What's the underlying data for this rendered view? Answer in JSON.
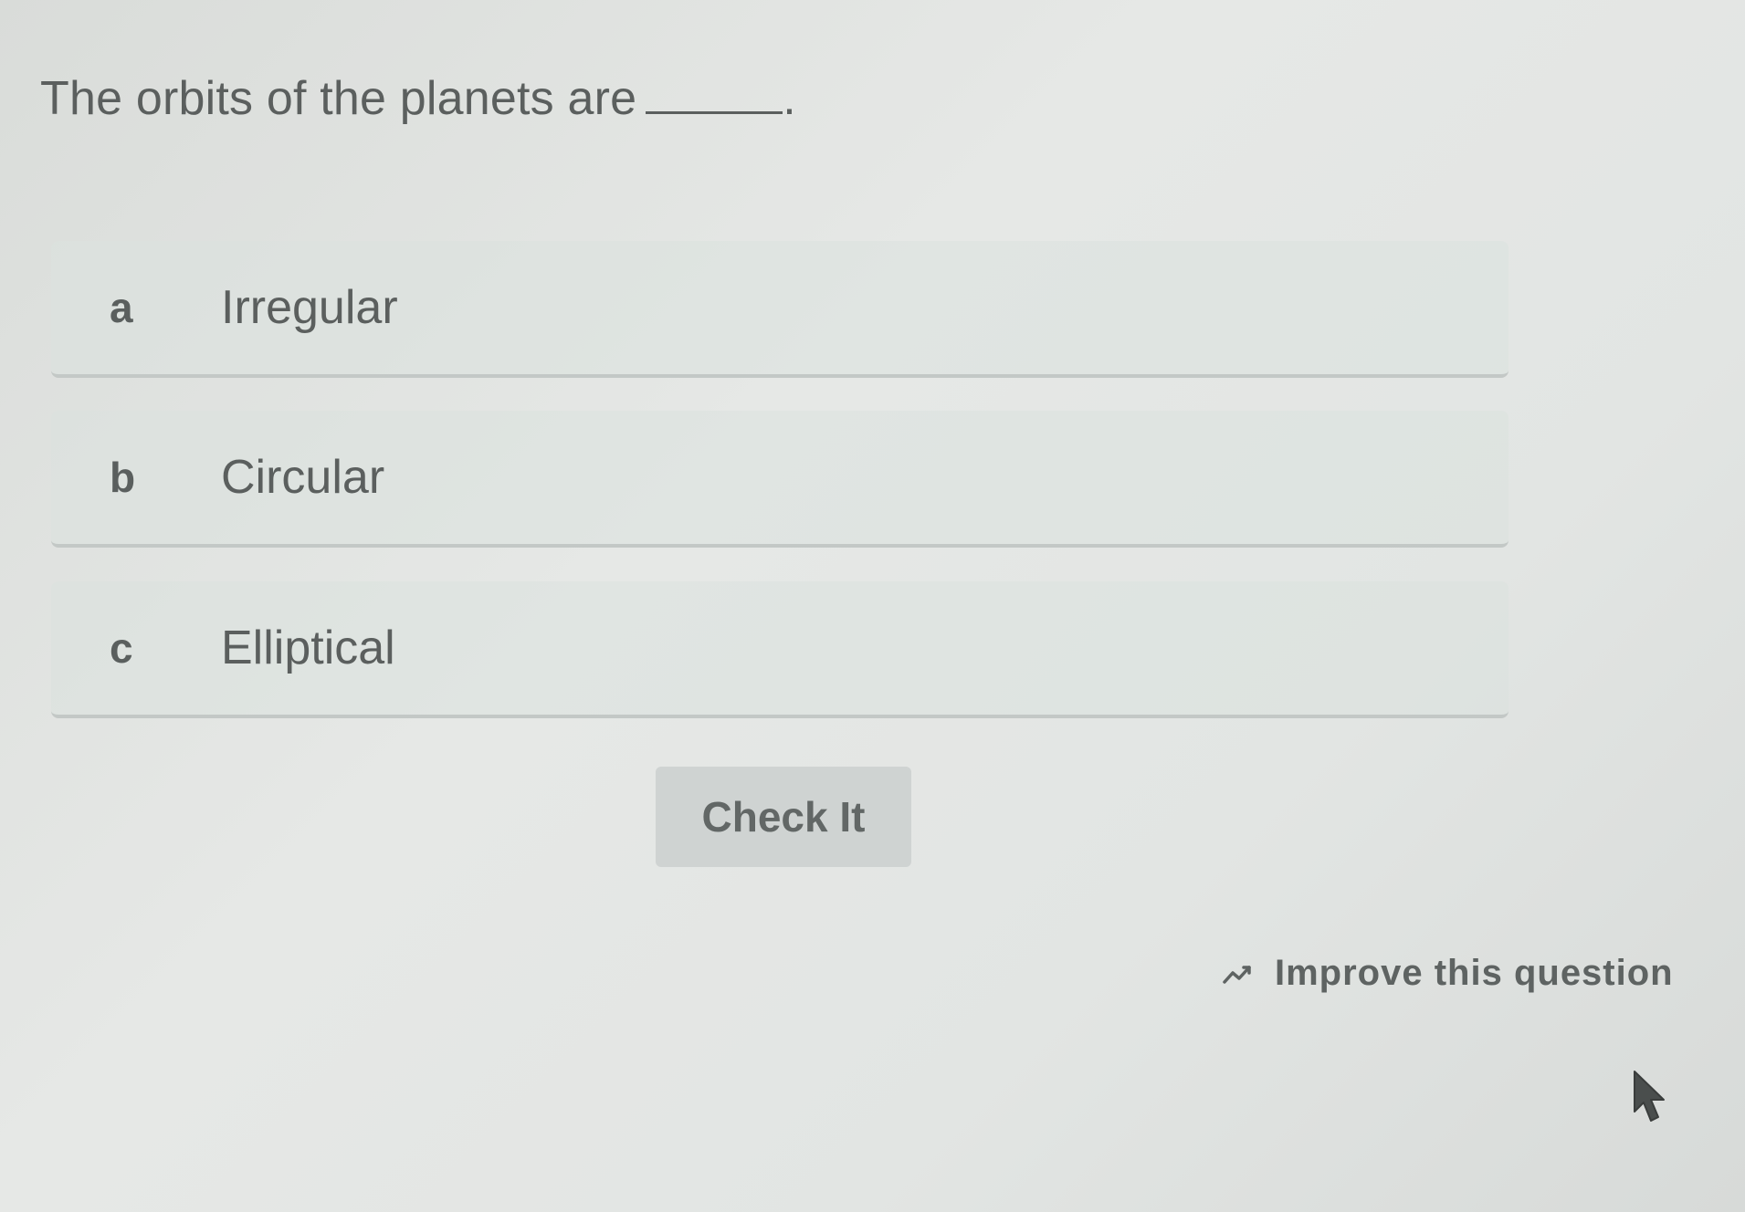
{
  "question": {
    "text": "The orbits of the planets are",
    "trailing": "."
  },
  "options": [
    {
      "letter": "a",
      "label": "Irregular"
    },
    {
      "letter": "b",
      "label": "Circular"
    },
    {
      "letter": "c",
      "label": "Elliptical"
    }
  ],
  "actions": {
    "check_label": "Check It",
    "improve_label": "Improve this question",
    "improve_icon": "trend-line-icon"
  }
}
